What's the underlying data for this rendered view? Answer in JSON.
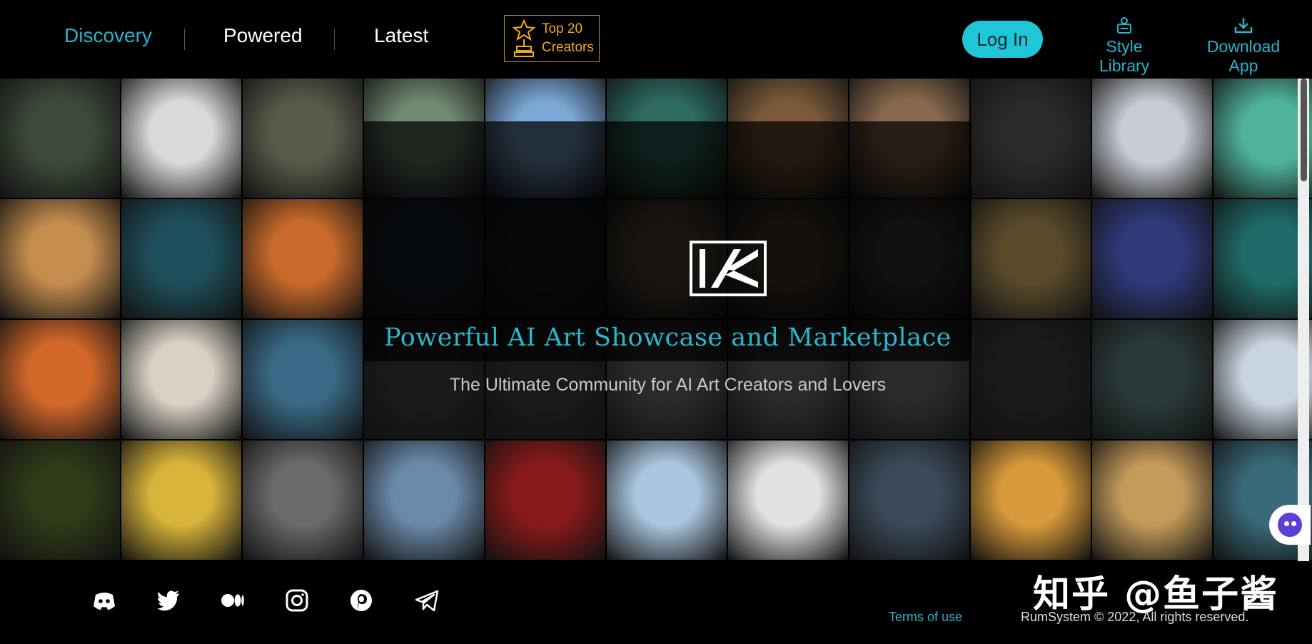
{
  "nav": {
    "discovery": "Discovery",
    "powered": "Powered",
    "latest": "Latest",
    "top20_label": "Top 20\nCreators",
    "login": "Log In",
    "style_library": "Style Library",
    "download_app": "Download App"
  },
  "hero": {
    "title": "Powerful AI Art Showcase and Marketplace",
    "subtitle": "The Ultimate Community for AI Art Creators and Lovers"
  },
  "gallery": {
    "rows": [
      [
        "#3d4a3a",
        "#d9d9d9",
        "#5a5a4a",
        "#6f8a70",
        "#7aa7d6",
        "#2e6b62",
        "#7a5a3a",
        "#8a6a4e",
        "#2a2a2a",
        "#c8cdd4",
        "#4fb39b"
      ],
      [
        "#c48c4d",
        "#1f4f5c",
        "#c86a2a",
        "#1c2a3a",
        "#1a1a1a",
        "#5a4a3a",
        "#4a3a2a",
        "#3a3a3a",
        "#5a4a2a",
        "#2e3a7a",
        "#1e6a68"
      ],
      [
        "#d4682a",
        "#d8d2c4",
        "#3a6a86",
        "#1a1a1a",
        "#1a1a1a",
        "#2a2a2a",
        "#2a2a2a",
        "#2a2a2a",
        "#1a1a1a",
        "#2a3a3a",
        "#c8d4e0"
      ],
      [
        "#2e3a18",
        "#d8b43a",
        "#6a6a6a",
        "#6a8aaa",
        "#8a1a1a",
        "#aac6e0",
        "#e2e2e2",
        "#3a4a5a",
        "#d89a3a",
        "#c49a5a",
        "#3a6a7a"
      ]
    ]
  },
  "footer": {
    "terms": "Terms of use",
    "copyright": "RumSystem © 2022, All rights reserved.",
    "watermark": "知乎 @鱼子酱"
  },
  "colors": {
    "accent": "#27b4c9",
    "login_bg": "#1fc6d8",
    "gold": "#f2a91d"
  },
  "social_icons": [
    "discord-icon",
    "twitter-icon",
    "medium-icon",
    "instagram-icon",
    "pinterest-icon",
    "telegram-icon"
  ]
}
